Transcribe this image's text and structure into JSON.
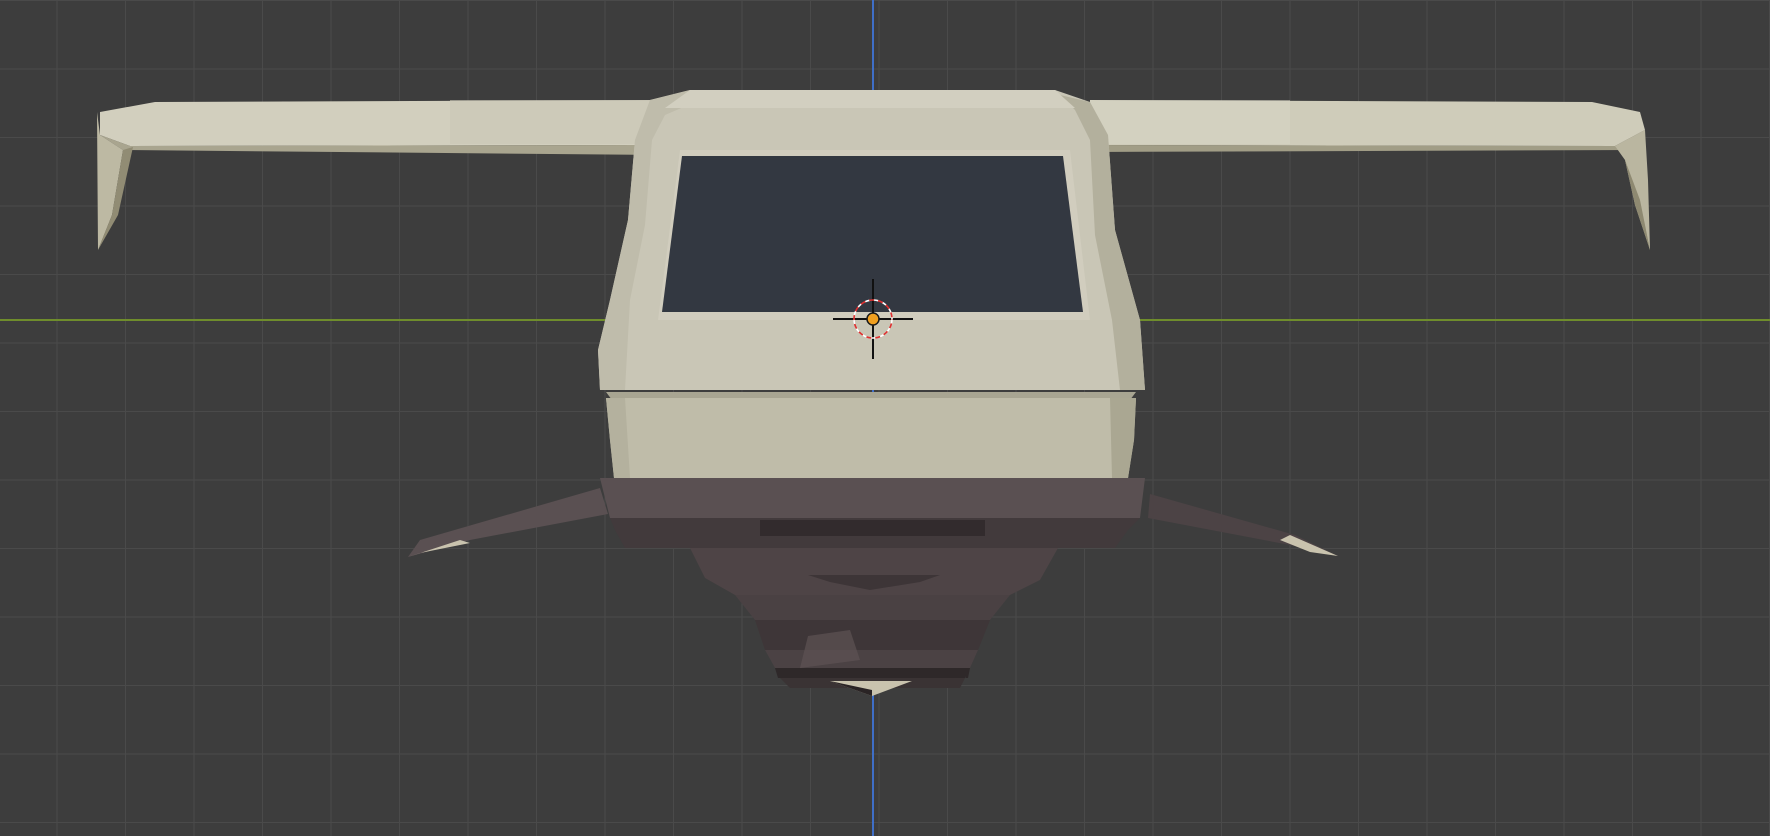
{
  "viewport": {
    "background_color": "#3d3d3d",
    "grid_color": "#4a4a4a",
    "axis_x_color": "#6f8d2c",
    "axis_z_color": "#3f6fc8"
  },
  "model": {
    "hull_color": "#c7c4b4",
    "window_color": "#333841",
    "base_color": "#4e4446"
  },
  "origin_marker_color": "#f0a020",
  "cursor_icon": "3d-cursor-icon"
}
